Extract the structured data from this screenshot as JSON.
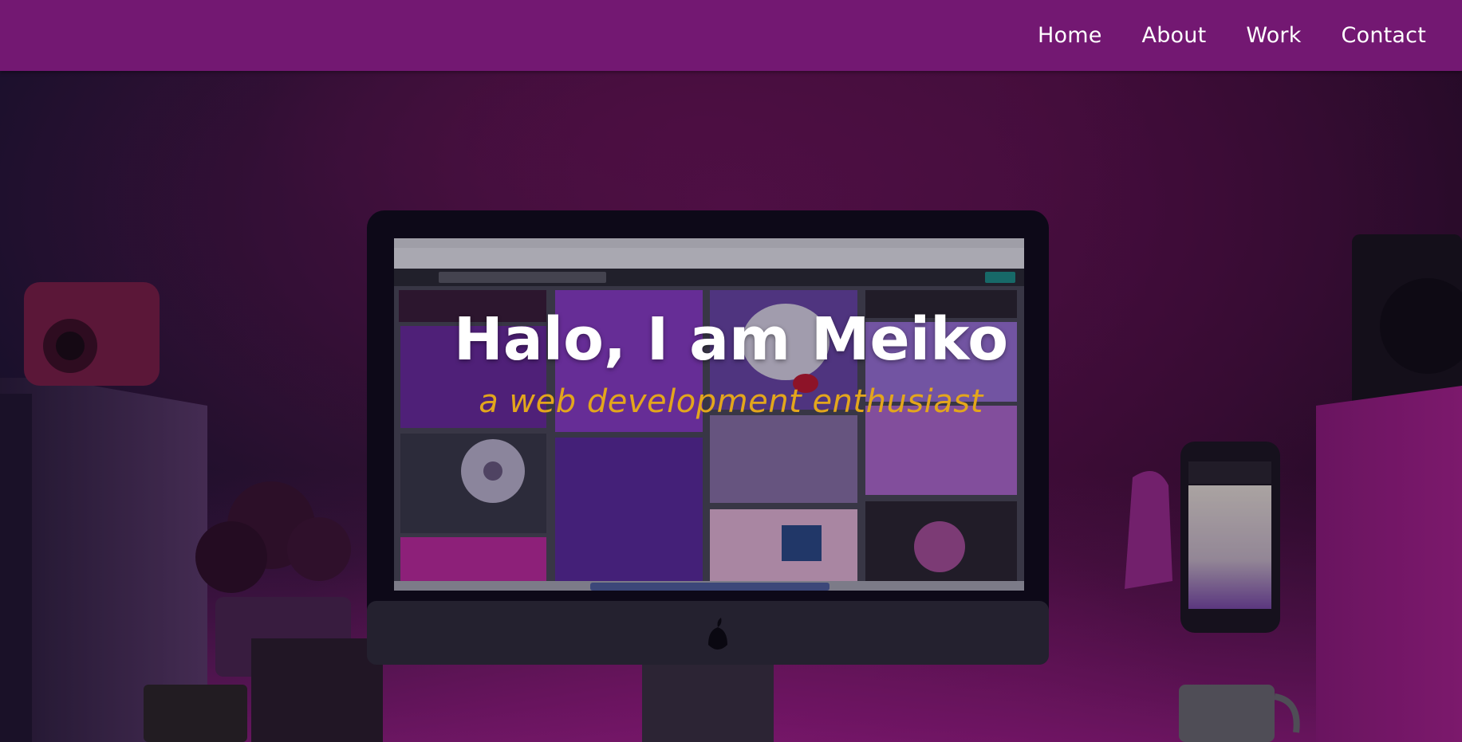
{
  "nav": {
    "items": [
      {
        "label": "Home"
      },
      {
        "label": "About"
      },
      {
        "label": "Work"
      },
      {
        "label": "Contact"
      }
    ]
  },
  "hero": {
    "title": "Halo, I am Meiko",
    "subtitle": "a web development enthusiast"
  },
  "colors": {
    "navbar": "#731872",
    "title": "#ffffff",
    "subtitle": "#e3a61c",
    "accent_purple": "#7a1468"
  }
}
